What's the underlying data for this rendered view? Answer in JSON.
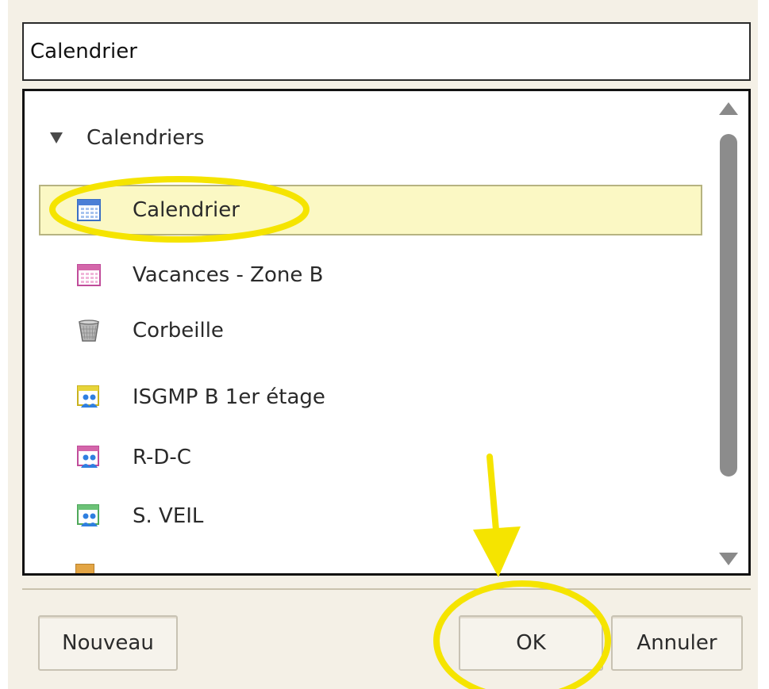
{
  "dialog": {
    "name_value": "Calendrier",
    "tree": {
      "header": "Calendriers",
      "items": [
        {
          "label": "Calendrier",
          "icon": "calendar-blue-icon",
          "selected": true
        },
        {
          "label": "Vacances - Zone B",
          "icon": "calendar-pink-icon",
          "selected": false
        },
        {
          "label": "Corbeille",
          "icon": "trash-bin-icon",
          "selected": false
        },
        {
          "label": "ISGMP B 1er étage",
          "icon": "group-calendar-yellow-icon",
          "selected": false
        },
        {
          "label": "R-D-C",
          "icon": "group-calendar-pink-icon",
          "selected": false
        },
        {
          "label": "S. VEIL",
          "icon": "group-calendar-green-icon",
          "selected": false
        }
      ]
    },
    "buttons": {
      "new_label": "Nouveau",
      "ok_label": "OK",
      "cancel_label": "Annuler"
    }
  },
  "colors": {
    "selection_fill": "#fbf8c4",
    "annotation_yellow": "#f5e400",
    "dialog_bg": "#f4f0e6"
  }
}
